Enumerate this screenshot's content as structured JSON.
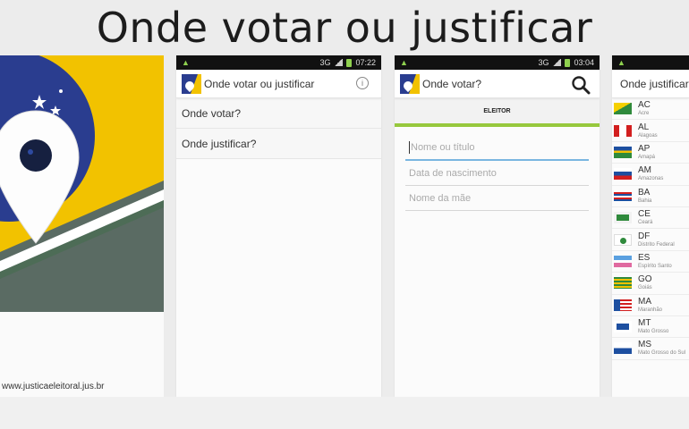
{
  "headline": "Onde votar ou justificar",
  "colors": {
    "navy": "#2a3d8f",
    "yellow": "#f2c200",
    "gray_green": "#5a6b63",
    "accent_green": "#97c83d",
    "field_focus": "#7ab6e0"
  },
  "splash": {
    "url": "www.justicaeleitoral.jus.br",
    "logo_icon": "map-pin-icon"
  },
  "phone1": {
    "status_time": "07:22",
    "status_network": "3G",
    "app_title": "Onde votar ou justificar",
    "menu_items": [
      "Onde votar?",
      "Onde justificar?"
    ]
  },
  "phone2": {
    "status_time": "03:04",
    "status_network": "3G",
    "app_title": "Onde votar?",
    "tab_label": "ELEITOR",
    "fields": [
      "Nome ou título",
      "Data de nascimento",
      "Nome da mãe"
    ]
  },
  "phone3": {
    "app_title": "Onde justificar?",
    "states": [
      {
        "code": "AC",
        "name": "Acre"
      },
      {
        "code": "AL",
        "name": "Alagoas"
      },
      {
        "code": "AP",
        "name": "Amapá"
      },
      {
        "code": "AM",
        "name": "Amazonas"
      },
      {
        "code": "BA",
        "name": "Bahia"
      },
      {
        "code": "CE",
        "name": "Ceará"
      },
      {
        "code": "DF",
        "name": "Distrito Federal"
      },
      {
        "code": "ES",
        "name": "Espírito Santo"
      },
      {
        "code": "GO",
        "name": "Goiás"
      },
      {
        "code": "MA",
        "name": "Maranhão"
      },
      {
        "code": "MT",
        "name": "Mato Grosso"
      },
      {
        "code": "MS",
        "name": "Mato Grosso do Sul"
      }
    ]
  }
}
